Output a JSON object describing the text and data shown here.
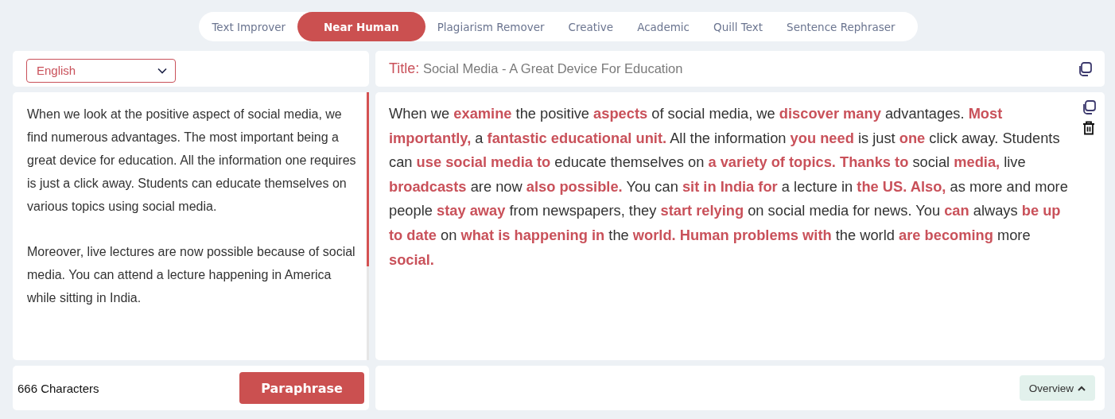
{
  "tabs": [
    {
      "label": "Text Improver",
      "selected": false
    },
    {
      "label": "Near Human",
      "selected": true
    },
    {
      "label": "Plagiarism Remover",
      "selected": false
    },
    {
      "label": "Creative",
      "selected": false
    },
    {
      "label": "Academic",
      "selected": false
    },
    {
      "label": "Quill Text",
      "selected": false
    },
    {
      "label": "Sentence Rephraser",
      "selected": false
    }
  ],
  "language_select": {
    "value": "English"
  },
  "input": {
    "paragraphs": [
      "When we look at the positive aspect of social media, we find numerous advantages. The most important being a great device for education. All the information one requires is just a click away. Students can educate themselves on various topics using social media.",
      "Moreover, live lectures are now possible because of social media. You can attend a lecture happening in America while sitting in India."
    ],
    "scrollbar": {
      "level": 0.65
    }
  },
  "character_count": "666 Characters",
  "paraphrase_button": "Paraphrase",
  "title": {
    "label": "Title:",
    "value": "Social Media - A Great Device For Education"
  },
  "output": {
    "text": "When we **examine** the positive **aspects** of social media, we **discover many** advantages. **Most importantly,** a **fantastic educational unit.** All the information **you need** is just **one** click away. Students can **use social media to** educate themselves on **a variety of topics. Thanks to** social **media,** live **broadcasts** are now **also possible.** You can **sit in India for** a lecture in **the US. Also,** as more and more people **stay away** from newspapers, they **start relying** on social media for news. You **can** always **be up to date** on **what is happening in** the **world. Human problems with** the world **are becoming** more **social.**"
  },
  "overview_button": "Overview"
}
